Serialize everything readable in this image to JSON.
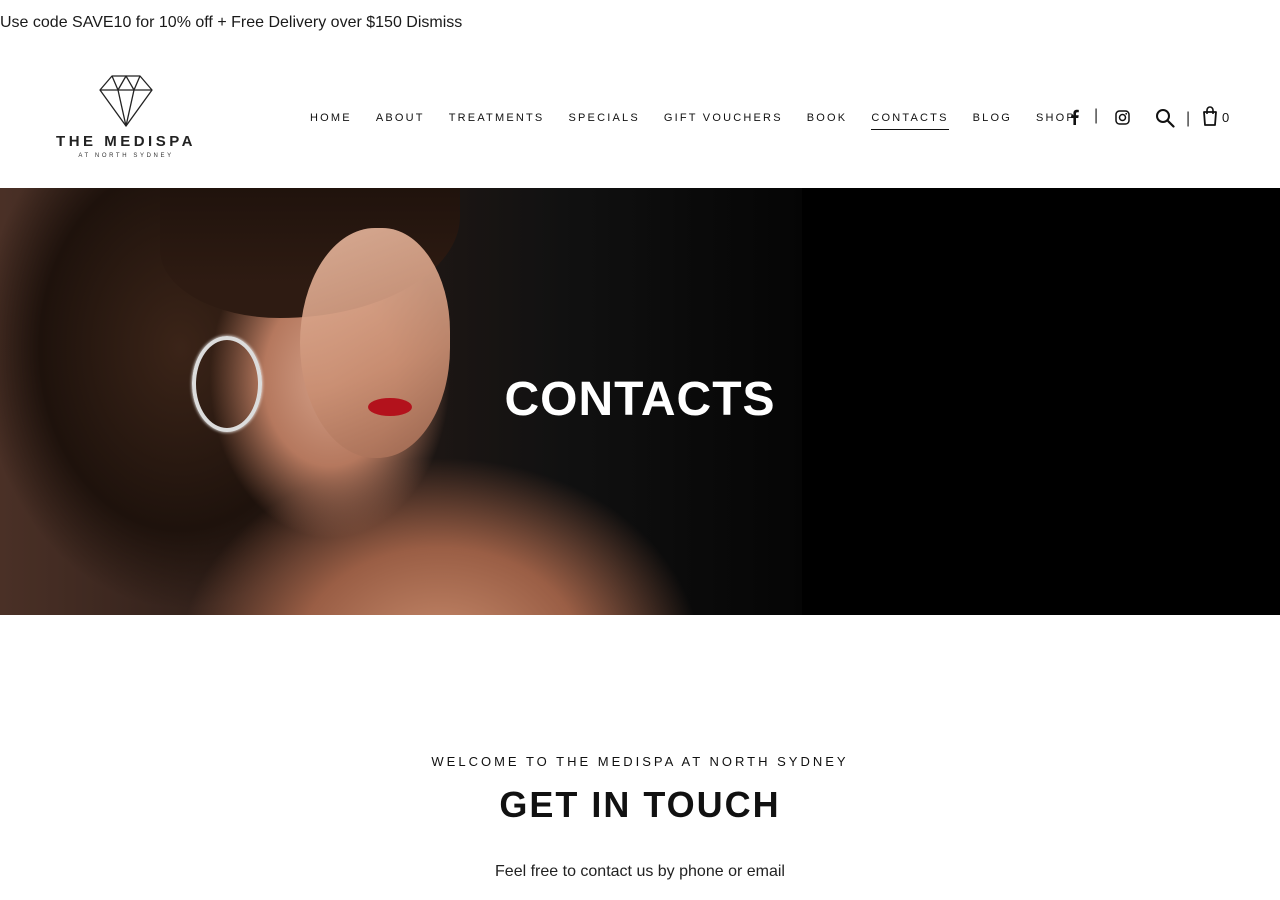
{
  "promo": {
    "message": "Use code SAVE10 for 10% off + Free Delivery over $150",
    "dismiss_label": "Dismiss"
  },
  "logo": {
    "title": "THE MEDISPA",
    "subtitle": "AT NORTH SYDNEY",
    "icon": "diamond-icon"
  },
  "nav": {
    "items": [
      {
        "label": "HOME"
      },
      {
        "label": "ABOUT"
      },
      {
        "label": "TREATMENTS"
      },
      {
        "label": "SPECIALS"
      },
      {
        "label": "GIFT VOUCHERS"
      },
      {
        "label": "BOOK"
      },
      {
        "label": "CONTACTS",
        "active": true
      },
      {
        "label": "BLOG"
      },
      {
        "label": "SHOP"
      }
    ]
  },
  "header_icons": {
    "facebook": "facebook-icon",
    "instagram": "instagram-icon",
    "search": "search-icon",
    "cart": "shopping-bag-icon",
    "separator": "|",
    "cart_count": "0"
  },
  "hero": {
    "title": "CONTACTS"
  },
  "intro": {
    "eyebrow": "WELCOME TO THE MEDISPA AT NORTH SYDNEY",
    "heading": "GET IN TOUCH",
    "text": "Feel free to contact us by phone or email"
  },
  "colors": {
    "text": "#111111",
    "hero_bg": "#000000",
    "lips_accent": "#b3121c"
  }
}
